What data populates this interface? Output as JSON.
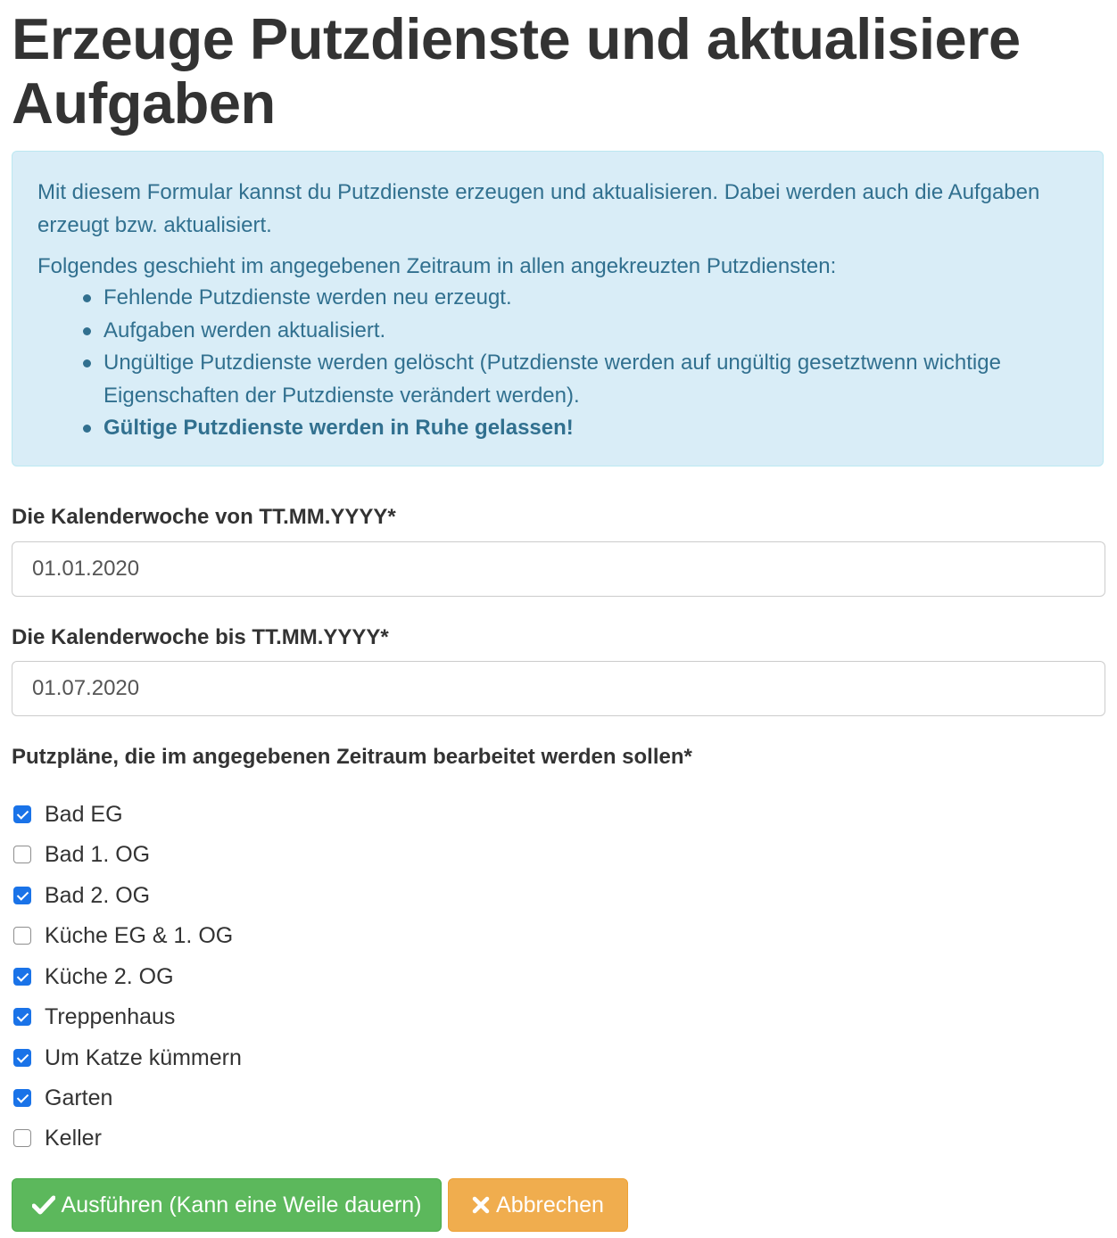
{
  "page": {
    "title": "Erzeuge Putzdienste und aktualisiere Aufgaben"
  },
  "info": {
    "intro": "Mit diesem Formular kannst du Putzdienste erzeugen und aktualisieren. Dabei werden auch die Aufgaben erzeugt bzw. aktualisiert.",
    "lead": "Folgendes geschieht im angegebenen Zeitraum in allen angekreuzten Putzdiensten:",
    "items": [
      "Fehlende Putzdienste werden neu erzeugt.",
      "Aufgaben werden aktualisiert.",
      "Ungültige Putzdienste werden gelöscht (Putzdienste werden auf ungültig gesetztwenn wichtige Eigenschaften der Putzdienste verändert werden).",
      "Gültige Putzdienste werden in Ruhe gelassen!"
    ]
  },
  "form": {
    "from_label": "Die Kalenderwoche von TT.MM.YYYY*",
    "from_value": "01.01.2020",
    "to_label": "Die Kalenderwoche bis TT.MM.YYYY*",
    "to_value": "01.07.2020",
    "plans_label": "Putzpläne, die im angegebenen Zeitraum bearbeitet werden sollen*",
    "plans": [
      {
        "label": "Bad EG",
        "checked": true
      },
      {
        "label": "Bad 1. OG",
        "checked": false
      },
      {
        "label": "Bad 2. OG",
        "checked": true
      },
      {
        "label": "Küche EG & 1. OG",
        "checked": false
      },
      {
        "label": "Küche 2. OG",
        "checked": true
      },
      {
        "label": "Treppenhaus",
        "checked": true
      },
      {
        "label": "Um Katze kümmern",
        "checked": true
      },
      {
        "label": "Garten",
        "checked": true
      },
      {
        "label": "Keller",
        "checked": false
      }
    ]
  },
  "buttons": {
    "run_label": "Ausführen (Kann eine Weile dauern)",
    "run_icon": "check-icon",
    "cancel_label": "Abbrechen",
    "cancel_icon": "close-icon"
  },
  "colors": {
    "info_background": "#d9edf7",
    "info_text": "#31708f",
    "run_button": "#5cb85c",
    "cancel_button": "#f0ad4e",
    "checkbox_checked": "#1a73e8"
  }
}
